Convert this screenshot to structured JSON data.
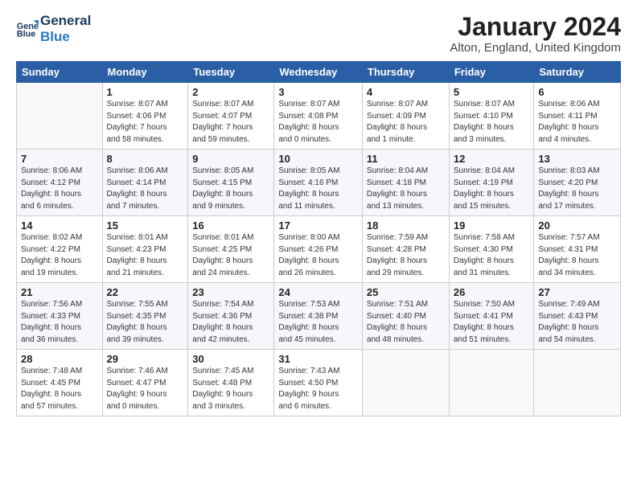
{
  "header": {
    "logo_line1": "General",
    "logo_line2": "Blue",
    "month": "January 2024",
    "location": "Alton, England, United Kingdom"
  },
  "weekdays": [
    "Sunday",
    "Monday",
    "Tuesday",
    "Wednesday",
    "Thursday",
    "Friday",
    "Saturday"
  ],
  "weeks": [
    [
      {
        "day": "",
        "info": ""
      },
      {
        "day": "1",
        "info": "Sunrise: 8:07 AM\nSunset: 4:06 PM\nDaylight: 7 hours\nand 58 minutes."
      },
      {
        "day": "2",
        "info": "Sunrise: 8:07 AM\nSunset: 4:07 PM\nDaylight: 7 hours\nand 59 minutes."
      },
      {
        "day": "3",
        "info": "Sunrise: 8:07 AM\nSunset: 4:08 PM\nDaylight: 8 hours\nand 0 minutes."
      },
      {
        "day": "4",
        "info": "Sunrise: 8:07 AM\nSunset: 4:09 PM\nDaylight: 8 hours\nand 1 minute."
      },
      {
        "day": "5",
        "info": "Sunrise: 8:07 AM\nSunset: 4:10 PM\nDaylight: 8 hours\nand 3 minutes."
      },
      {
        "day": "6",
        "info": "Sunrise: 8:06 AM\nSunset: 4:11 PM\nDaylight: 8 hours\nand 4 minutes."
      }
    ],
    [
      {
        "day": "7",
        "info": "Sunrise: 8:06 AM\nSunset: 4:12 PM\nDaylight: 8 hours\nand 6 minutes."
      },
      {
        "day": "8",
        "info": "Sunrise: 8:06 AM\nSunset: 4:14 PM\nDaylight: 8 hours\nand 7 minutes."
      },
      {
        "day": "9",
        "info": "Sunrise: 8:05 AM\nSunset: 4:15 PM\nDaylight: 8 hours\nand 9 minutes."
      },
      {
        "day": "10",
        "info": "Sunrise: 8:05 AM\nSunset: 4:16 PM\nDaylight: 8 hours\nand 11 minutes."
      },
      {
        "day": "11",
        "info": "Sunrise: 8:04 AM\nSunset: 4:18 PM\nDaylight: 8 hours\nand 13 minutes."
      },
      {
        "day": "12",
        "info": "Sunrise: 8:04 AM\nSunset: 4:19 PM\nDaylight: 8 hours\nand 15 minutes."
      },
      {
        "day": "13",
        "info": "Sunrise: 8:03 AM\nSunset: 4:20 PM\nDaylight: 8 hours\nand 17 minutes."
      }
    ],
    [
      {
        "day": "14",
        "info": "Sunrise: 8:02 AM\nSunset: 4:22 PM\nDaylight: 8 hours\nand 19 minutes."
      },
      {
        "day": "15",
        "info": "Sunrise: 8:01 AM\nSunset: 4:23 PM\nDaylight: 8 hours\nand 21 minutes."
      },
      {
        "day": "16",
        "info": "Sunrise: 8:01 AM\nSunset: 4:25 PM\nDaylight: 8 hours\nand 24 minutes."
      },
      {
        "day": "17",
        "info": "Sunrise: 8:00 AM\nSunset: 4:26 PM\nDaylight: 8 hours\nand 26 minutes."
      },
      {
        "day": "18",
        "info": "Sunrise: 7:59 AM\nSunset: 4:28 PM\nDaylight: 8 hours\nand 29 minutes."
      },
      {
        "day": "19",
        "info": "Sunrise: 7:58 AM\nSunset: 4:30 PM\nDaylight: 8 hours\nand 31 minutes."
      },
      {
        "day": "20",
        "info": "Sunrise: 7:57 AM\nSunset: 4:31 PM\nDaylight: 8 hours\nand 34 minutes."
      }
    ],
    [
      {
        "day": "21",
        "info": "Sunrise: 7:56 AM\nSunset: 4:33 PM\nDaylight: 8 hours\nand 36 minutes."
      },
      {
        "day": "22",
        "info": "Sunrise: 7:55 AM\nSunset: 4:35 PM\nDaylight: 8 hours\nand 39 minutes."
      },
      {
        "day": "23",
        "info": "Sunrise: 7:54 AM\nSunset: 4:36 PM\nDaylight: 8 hours\nand 42 minutes."
      },
      {
        "day": "24",
        "info": "Sunrise: 7:53 AM\nSunset: 4:38 PM\nDaylight: 8 hours\nand 45 minutes."
      },
      {
        "day": "25",
        "info": "Sunrise: 7:51 AM\nSunset: 4:40 PM\nDaylight: 8 hours\nand 48 minutes."
      },
      {
        "day": "26",
        "info": "Sunrise: 7:50 AM\nSunset: 4:41 PM\nDaylight: 8 hours\nand 51 minutes."
      },
      {
        "day": "27",
        "info": "Sunrise: 7:49 AM\nSunset: 4:43 PM\nDaylight: 8 hours\nand 54 minutes."
      }
    ],
    [
      {
        "day": "28",
        "info": "Sunrise: 7:48 AM\nSunset: 4:45 PM\nDaylight: 8 hours\nand 57 minutes."
      },
      {
        "day": "29",
        "info": "Sunrise: 7:46 AM\nSunset: 4:47 PM\nDaylight: 9 hours\nand 0 minutes."
      },
      {
        "day": "30",
        "info": "Sunrise: 7:45 AM\nSunset: 4:48 PM\nDaylight: 9 hours\nand 3 minutes."
      },
      {
        "day": "31",
        "info": "Sunrise: 7:43 AM\nSunset: 4:50 PM\nDaylight: 9 hours\nand 6 minutes."
      },
      {
        "day": "",
        "info": ""
      },
      {
        "day": "",
        "info": ""
      },
      {
        "day": "",
        "info": ""
      }
    ]
  ]
}
